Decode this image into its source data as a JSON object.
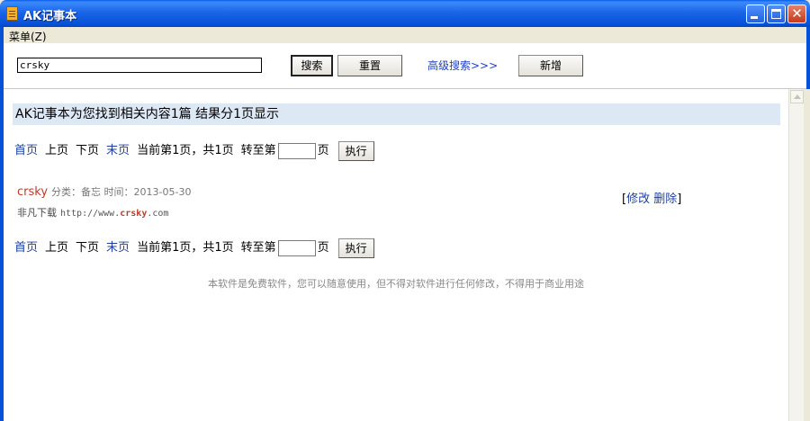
{
  "window": {
    "title": "AK记事本"
  },
  "menu": {
    "label": "菜单(Z)"
  },
  "toolbar": {
    "search_value": "crsky",
    "search_button": "搜索",
    "reset_button": "重置",
    "advanced_link": "高级搜索>>>",
    "add_button": "新增"
  },
  "results": {
    "header": "AK记事本为您找到相关内容1篇 结果分1页显示"
  },
  "pager": {
    "first": "首页",
    "prev": "上页",
    "next": "下页",
    "last": "末页",
    "status": "当前第1页，共1页",
    "goto_prefix": "转至第",
    "goto_suffix": "页",
    "exec_button": "执行"
  },
  "entry": {
    "title": "crsky",
    "category": "分类：备忘 时间：2013-05-30",
    "body_text": "非凡下载",
    "url_prefix": "http://www.",
    "url_highlight": "crsky",
    "url_suffix": ".com",
    "bracket_open": "[",
    "edit": "修改",
    "delete": "删除",
    "bracket_close": "]"
  },
  "footer": {
    "text": "本软件是免费软件，您可以随意使用，但不得对软件进行任何修改，不得用于商业用途"
  },
  "colors": {
    "titlebar": "#0551d8",
    "link": "#1e3fa0",
    "entry_title": "#c0392b",
    "header_band": "#dce8f4"
  }
}
